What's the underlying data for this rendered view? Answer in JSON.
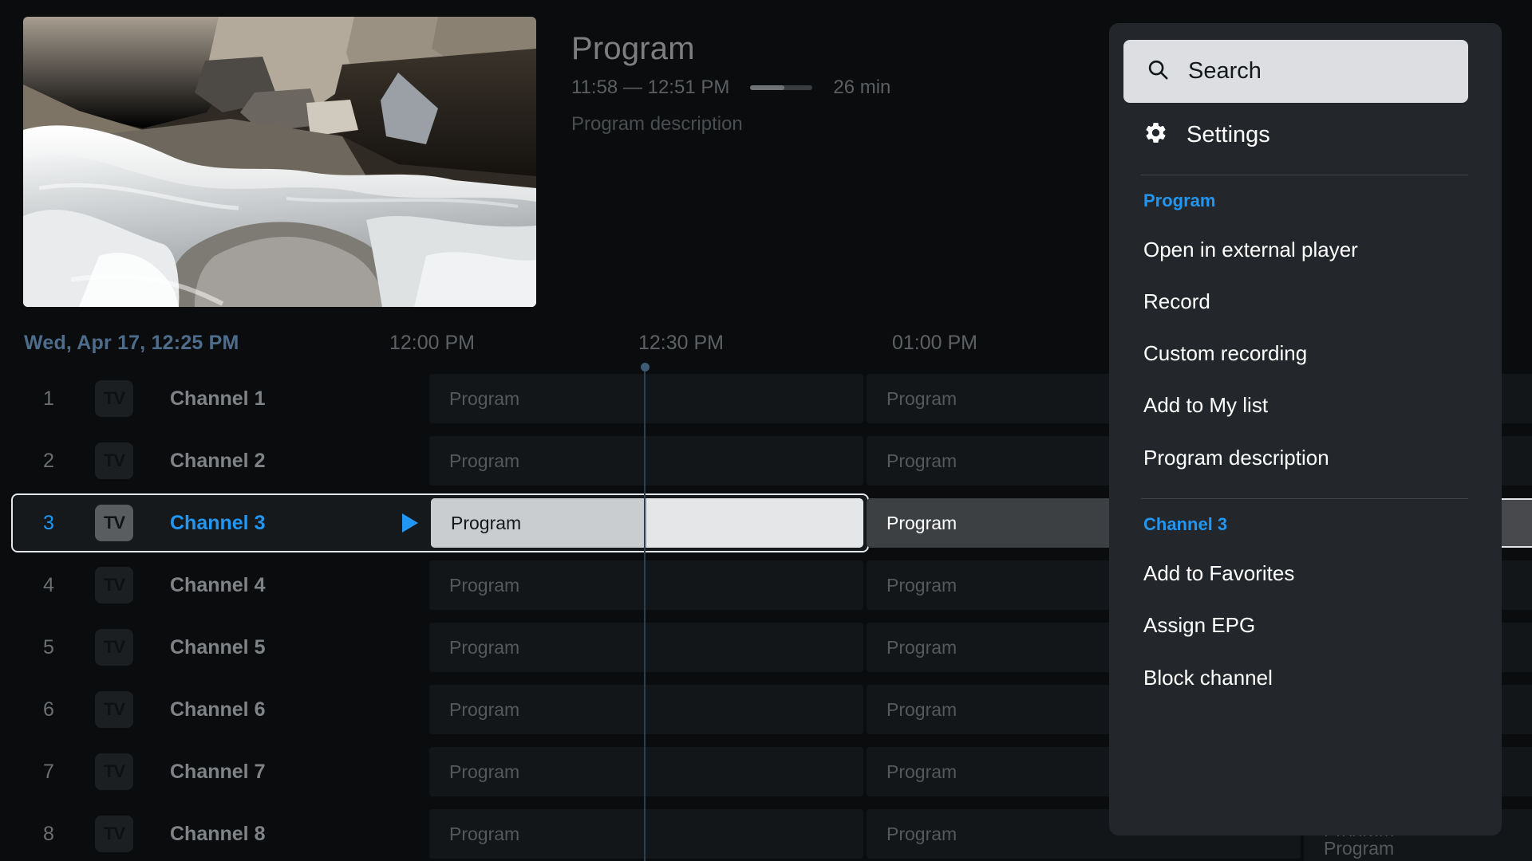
{
  "preview": {
    "title": "Program",
    "times": "11:58 — 12:51 PM",
    "duration": "26 min",
    "description": "Program description",
    "progress_percent": 55,
    "thumbnail_alt": "river-rapids-thumbnail"
  },
  "timeline": {
    "current": "Wed, Apr 17, 12:25 PM",
    "ticks": [
      "12:00 PM",
      "12:30 PM",
      "01:00 PM"
    ]
  },
  "grid": {
    "program_label": "Program",
    "logo_text": "TV",
    "selected_cell_progress_percent": 50,
    "rows": [
      {
        "num": "1",
        "name": "Channel 1",
        "selected": false
      },
      {
        "num": "2",
        "name": "Channel 2",
        "selected": false
      },
      {
        "num": "3",
        "name": "Channel 3",
        "selected": true
      },
      {
        "num": "4",
        "name": "Channel 4",
        "selected": false
      },
      {
        "num": "5",
        "name": "Channel 5",
        "selected": false
      },
      {
        "num": "6",
        "name": "Channel 6",
        "selected": false
      },
      {
        "num": "7",
        "name": "Channel 7",
        "selected": false
      },
      {
        "num": "8",
        "name": "Channel 8",
        "selected": false
      }
    ]
  },
  "menu": {
    "search_label": "Search",
    "settings_label": "Settings",
    "section_program": "Program",
    "section_channel": "Channel 3",
    "program_items": [
      "Open in external player",
      "Record",
      "Custom recording",
      "Add to My list",
      "Program description"
    ],
    "channel_items": [
      "Add to Favorites",
      "Assign EPG",
      "Block channel"
    ]
  },
  "colors": {
    "accent": "#2196f3",
    "panel_bg": "#23272b",
    "page_bg": "#0a0c0d",
    "highlight": "#e4e6e8",
    "date_text": "#4e6d8c"
  }
}
